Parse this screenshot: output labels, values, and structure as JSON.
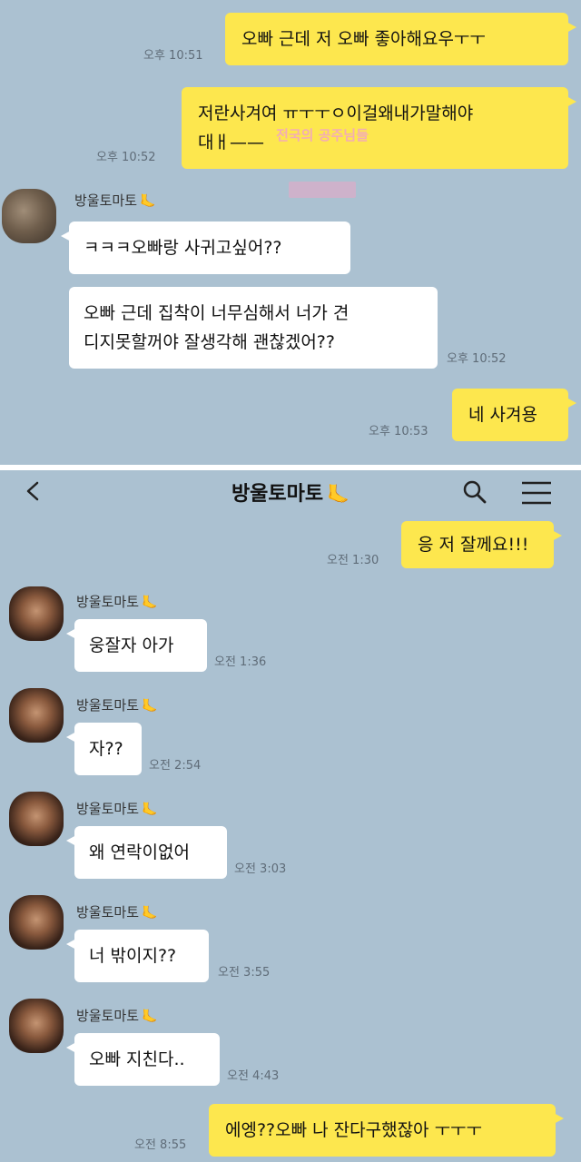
{
  "top_panel": {
    "messages": [
      {
        "text": "오빠 근데 저 오빠 좋아해요우ㅜㅜ",
        "time": "오후 10:51"
      },
      {
        "text": "저란사겨여 ㅠㅜㅜㅇ이걸왜내가말해야\n대ㅐ——",
        "time": "오후 10:52"
      },
      {
        "text": "ㅋㅋㅋ오빠랑 사귀고싶어??"
      },
      {
        "text": "오빠 근데 집착이 너무심해서 너가 견\n디지못할꺼야 잘생각해 괜찮겠어??",
        "time": "오후 10:52"
      },
      {
        "text": "네 사겨용",
        "time": "오후 10:53"
      }
    ],
    "sender": "방울토마토",
    "watermark": "전국의\n공주님들\n"
  },
  "bottom_panel": {
    "header": {
      "title": "방울토마토",
      "back_icon": "chevron-left-icon",
      "search_icon": "search-icon",
      "menu_icon": "hamburger-menu-icon"
    },
    "sender": "방울토마토",
    "messages": [
      {
        "text": "응 저 잘께요!!!",
        "time": "오전 1:30"
      },
      {
        "text": "웅잘자 아가",
        "time": "오전 1:36"
      },
      {
        "text": "자??",
        "time": "오전 2:54"
      },
      {
        "text": "왜 연락이없어",
        "time": "오전 3:03"
      },
      {
        "text": "너 밖이지??",
        "time": "오전 3:55"
      },
      {
        "text": "오빠 지친다..",
        "time": "오전 4:43"
      },
      {
        "text": "에엥??오빠 나 잔다구했잖아 ㅜㅜㅜ",
        "time": "오전 8:55"
      }
    ]
  },
  "colors": {
    "chat_background": "#abc1d1",
    "my_bubble": "#fde74e",
    "their_bubble": "#ffffff"
  }
}
